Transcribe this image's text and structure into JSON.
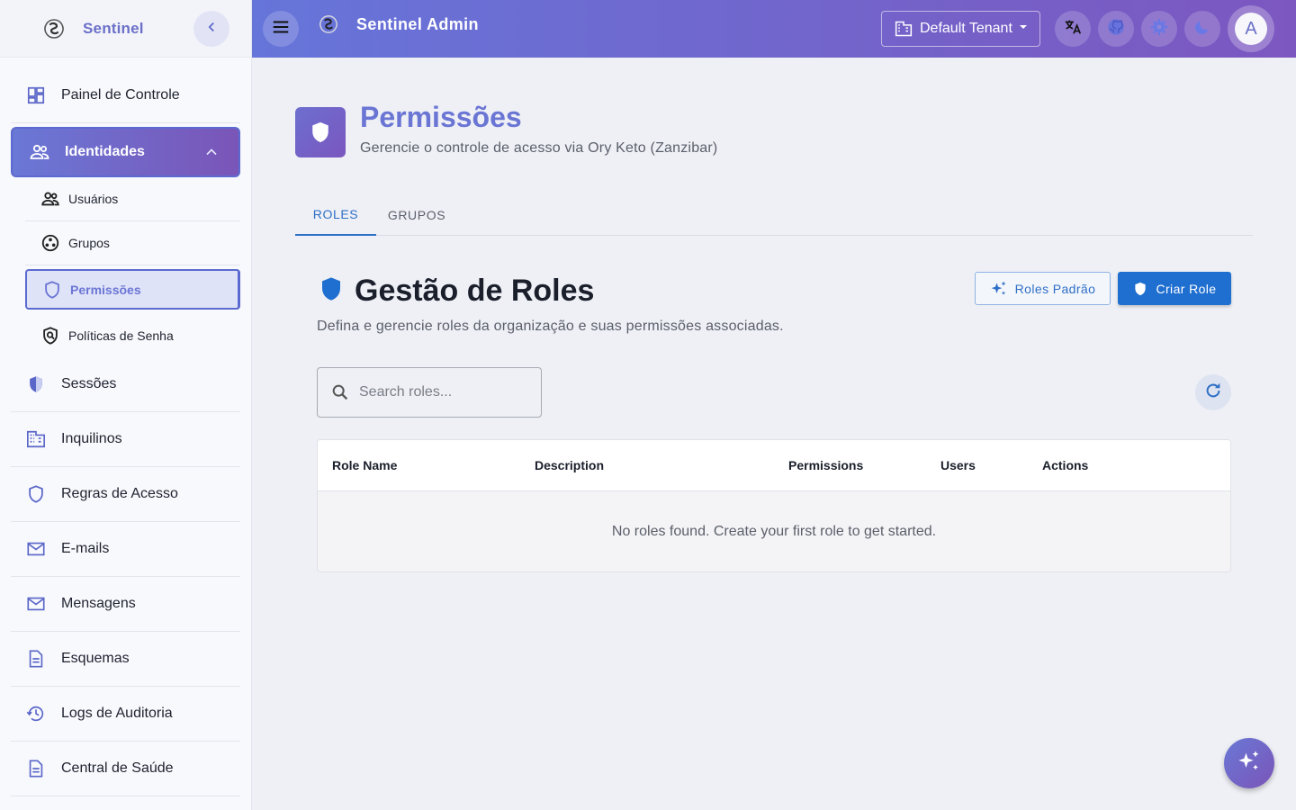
{
  "sidebar": {
    "brand": "Sentinel",
    "items": [
      {
        "label": "Painel de Controle",
        "icon": "dashboard-icon"
      },
      {
        "label": "Identidades",
        "icon": "people-icon"
      },
      {
        "label": "Sessões",
        "icon": "shield-half-icon"
      },
      {
        "label": "Inquilinos",
        "icon": "building-icon"
      },
      {
        "label": "Regras de Acesso",
        "icon": "shield-outline-icon"
      },
      {
        "label": "E-mails",
        "icon": "mail-icon"
      },
      {
        "label": "Mensagens",
        "icon": "mail-icon"
      },
      {
        "label": "Esquemas",
        "icon": "document-icon"
      },
      {
        "label": "Logs de Auditoria",
        "icon": "history-icon"
      },
      {
        "label": "Central de Saúde",
        "icon": "document-icon"
      }
    ],
    "sub_items": [
      {
        "label": "Usuários",
        "icon": "people-icon"
      },
      {
        "label": "Grupos",
        "icon": "group-work-icon"
      },
      {
        "label": "Permissões",
        "icon": "shield-outline-icon"
      },
      {
        "label": "Políticas de Senha",
        "icon": "policy-icon"
      }
    ]
  },
  "topbar": {
    "title": "Sentinel Admin",
    "tenant": "Default Tenant",
    "avatar": "A"
  },
  "page": {
    "title": "Permissões",
    "subtitle": "Gerencie o controle de acesso via Ory Keto (Zanzibar)"
  },
  "tabs": [
    {
      "label": "ROLES",
      "active": true
    },
    {
      "label": "GRUPOS",
      "active": false
    }
  ],
  "section": {
    "title": "Gestão de Roles",
    "description": "Defina e gerencie roles da organização e suas permissões associadas.",
    "default_roles_label": "Roles Padrão",
    "create_role_label": "Criar Role"
  },
  "search": {
    "placeholder": "Search roles...",
    "value": ""
  },
  "table": {
    "columns": [
      "Role Name",
      "Description",
      "Permissions",
      "Users",
      "Actions"
    ],
    "empty_message": "No roles found. Create your first role to get started."
  },
  "colors": {
    "accent": "#6a75d4",
    "primary_button": "#1f6fd0",
    "tab_active": "#2f6fc6"
  }
}
